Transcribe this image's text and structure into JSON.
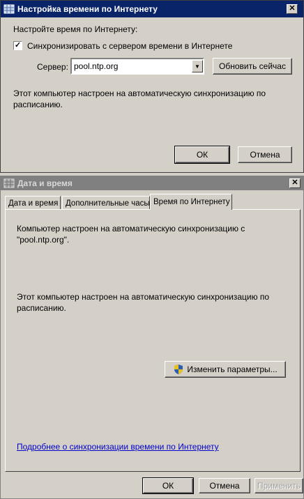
{
  "internet_time_dialog": {
    "title": "Настройка времени по Интернету",
    "heading": "Настройте время по Интернету:",
    "sync_checkbox": {
      "checked": true,
      "label": "Синхронизировать с сервером времени в Интернете"
    },
    "server_label": "Сервер:",
    "server_value": "pool.ntp.org",
    "update_now_button": "Обновить сейчас",
    "info_text": "Этот компьютер настроен на автоматическую синхронизацию по расписанию.",
    "ok_button": "ОК",
    "cancel_button": "Отмена"
  },
  "date_time_dialog": {
    "title": "Дата и время",
    "tabs": [
      {
        "label": "Дата и время",
        "active": false
      },
      {
        "label": "Дополнительные часы",
        "active": false
      },
      {
        "label": "Время по Интернету",
        "active": true
      }
    ],
    "sync_status_text": "Компьютер настроен на автоматическую синхронизацию с \"pool.ntp.org\".",
    "schedule_text": "Этот компьютер настроен на автоматическую синхронизацию по расписанию.",
    "change_settings_button": "Изменить параметры...",
    "more_info_link": "Подробнее о синхронизации времени по Интернету",
    "ok_button": "ОК",
    "cancel_button": "Отмена",
    "apply_button": "Применить"
  },
  "icons": {
    "clock_globe": "clock-globe-icon",
    "close": "close-icon",
    "dropdown": "chevron-down-icon",
    "uac_shield": "uac-shield-icon"
  },
  "colors": {
    "active_title": "#0a246a",
    "inactive_title": "#808080",
    "dialog_face": "#d4d0c8",
    "link": "#0000cc"
  }
}
